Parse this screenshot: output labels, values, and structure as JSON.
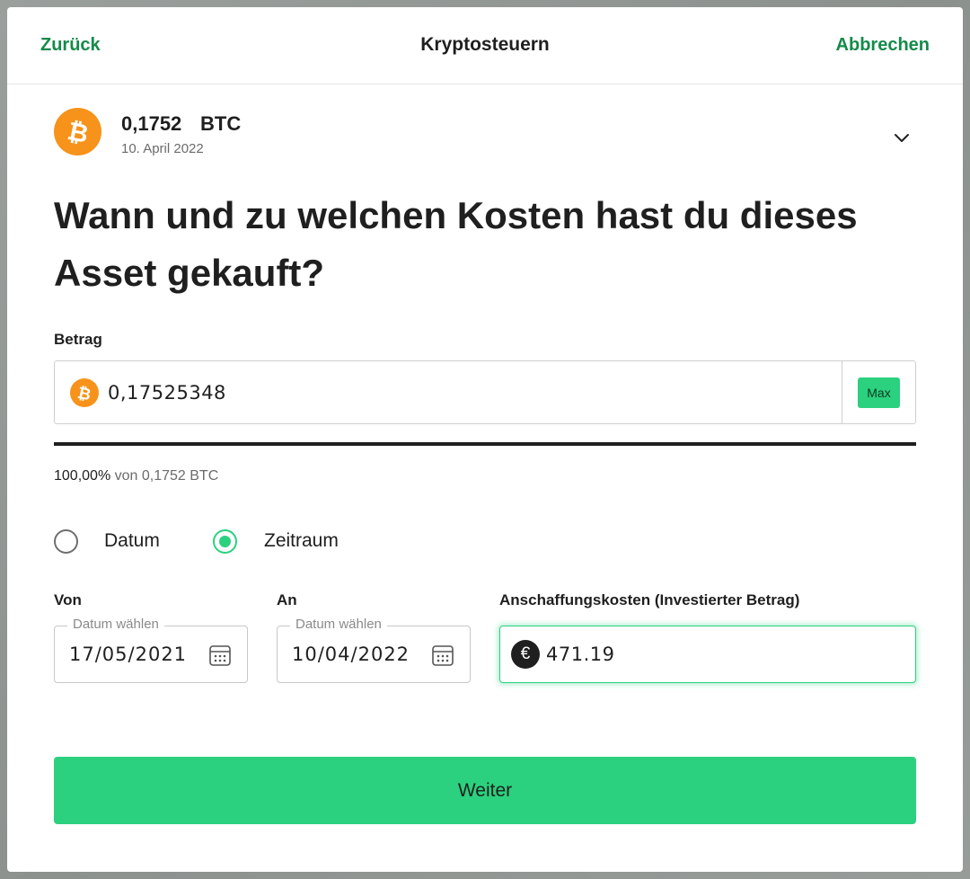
{
  "header": {
    "back_label": "Zurück",
    "title": "Kryptosteuern",
    "cancel_label": "Abbrechen"
  },
  "asset": {
    "amount": "0,1752",
    "symbol": "BTC",
    "date": "10. April 2022",
    "icon": "bitcoin-icon"
  },
  "question": "Wann und zu welchen Kosten hast du dieses Asset gekauft?",
  "amount_section": {
    "label": "Betrag",
    "value": "0,17525348",
    "max_label": "Max",
    "progress_fraction": 1.0,
    "percent_text": "100,00%",
    "of_text": "von 0,1752 BTC"
  },
  "mode": {
    "options": [
      {
        "label": "Datum",
        "selected": false
      },
      {
        "label": "Zeitraum",
        "selected": true
      }
    ]
  },
  "from": {
    "label": "Von",
    "legend": "Datum wählen",
    "value": "17/05/2021"
  },
  "to": {
    "label": "An",
    "legend": "Datum wählen",
    "value": "10/04/2022"
  },
  "cost": {
    "label": "Anschaffungskosten (Investierter Betrag)",
    "currency_symbol": "€",
    "value": "471.19"
  },
  "submit_label": "Weiter",
  "colors": {
    "accent_green": "#2bd17e",
    "link_green": "#148a4a",
    "bitcoin_orange": "#f7931a"
  }
}
